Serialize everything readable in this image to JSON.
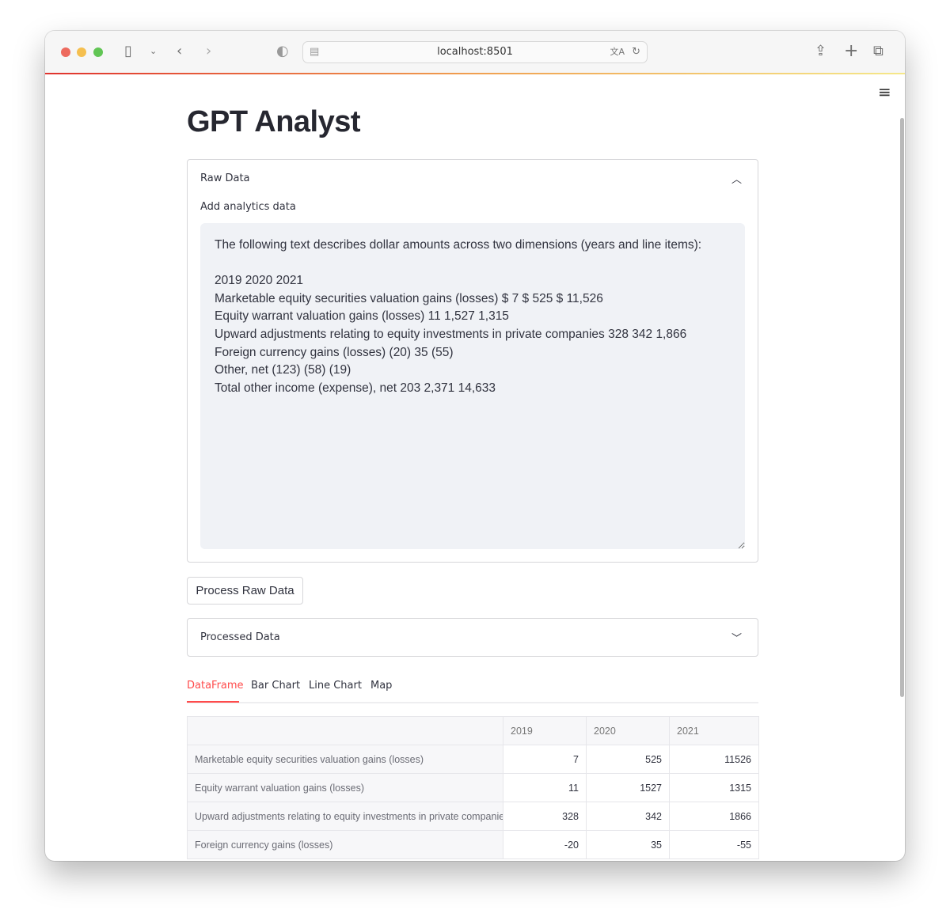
{
  "browser": {
    "url": "localhost:8501",
    "traffic_lights": [
      "#ed6a5e",
      "#f5bf4f",
      "#61c554"
    ]
  },
  "app": {
    "title": "GPT Analyst"
  },
  "raw_data": {
    "header": "Raw Data",
    "label": "Add analytics data",
    "text": "The following text describes dollar amounts across two dimensions (years and line items):\n\n2019 2020 2021\nMarketable equity securities valuation gains (losses) $ 7 $ 525 $ 11,526\nEquity warrant valuation gains (losses) 11 1,527 1,315\nUpward adjustments relating to equity investments in private companies 328 342 1,866\nForeign currency gains (losses) (20) 35 (55)\nOther, net (123) (58) (19)\nTotal other income (expense), net 203 2,371 14,633"
  },
  "process_button": "Process Raw Data",
  "processed_data": {
    "header": "Processed Data"
  },
  "tabs": [
    {
      "label": "DataFrame",
      "active": true
    },
    {
      "label": "Bar Chart"
    },
    {
      "label": "Line Chart"
    },
    {
      "label": "Map"
    }
  ],
  "accent": "#ff4b4b",
  "table": {
    "columns": [
      "",
      "2019",
      "2020",
      "2021"
    ],
    "rows": [
      {
        "label": "Marketable equity securities valuation gains (losses)",
        "values": [
          "7",
          "525",
          "11526"
        ]
      },
      {
        "label": "Equity warrant valuation gains (losses)",
        "values": [
          "11",
          "1527",
          "1315"
        ]
      },
      {
        "label": "Upward adjustments relating to equity investments in private companies",
        "values": [
          "328",
          "342",
          "1866"
        ]
      },
      {
        "label": "Foreign currency gains (losses)",
        "values": [
          "-20",
          "35",
          "-55"
        ]
      }
    ]
  }
}
